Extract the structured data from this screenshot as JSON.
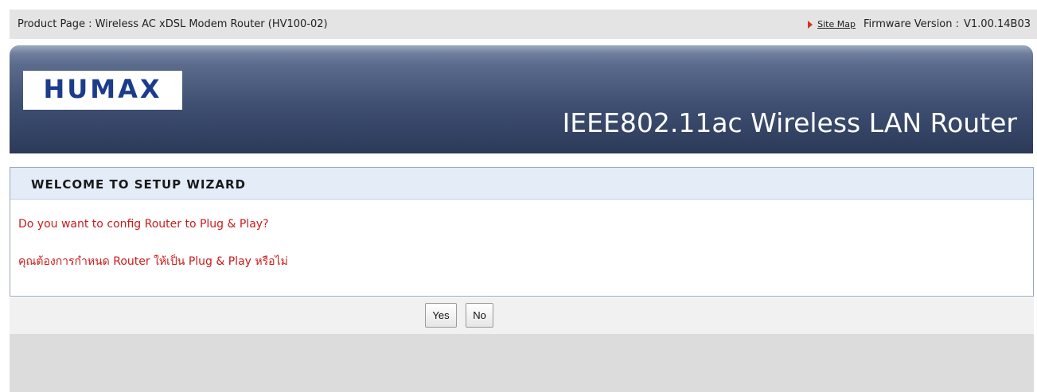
{
  "topbar": {
    "product_text": "Product Page : Wireless AC xDSL Modem Router (HV100-02)",
    "site_map_label": "Site Map",
    "firmware_label": "Firmware Version :",
    "firmware_value": "V1.00.14B03"
  },
  "banner": {
    "logo_text": "HUMAX",
    "title": "IEEE802.11ac Wireless LAN Router"
  },
  "wizard": {
    "heading": "WELCOME TO SETUP WIZARD",
    "question_en": "Do you want to config Router to Plug & Play?",
    "question_th": "คุณต้องการกำหนด Router ให้เป็น Plug & Play หรือไม่"
  },
  "buttons": {
    "yes_label": "Yes",
    "no_label": "No"
  },
  "colors": {
    "question_text": "#cc1a1a",
    "logo_blue": "#1b3c8a",
    "banner_dark": "#2c3a58",
    "header_bg": "#e3ecf7"
  },
  "icons": {
    "site_map_bullet": "red-triangle-right-icon"
  }
}
